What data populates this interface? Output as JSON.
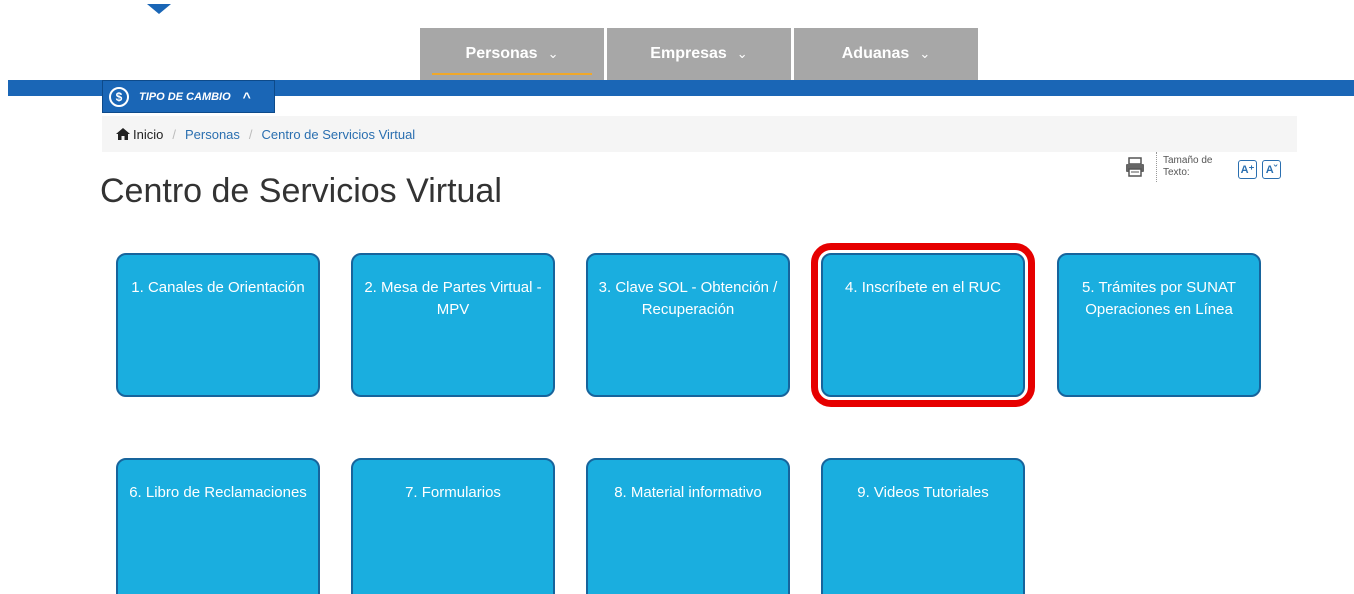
{
  "nav": {
    "tabs": [
      {
        "label": "Personas",
        "chevron": "⌄"
      },
      {
        "label": "Empresas",
        "chevron": "⌄"
      },
      {
        "label": "Aduanas",
        "chevron": "⌄"
      }
    ]
  },
  "tipo_cambio": {
    "label": "TIPO DE CAMBIO",
    "icon": "dollar-icon",
    "toggle": "^"
  },
  "breadcrumb": {
    "home": "Inicio",
    "level1": "Personas",
    "current": "Centro de Servicios Virtual",
    "separator": "/"
  },
  "tools": {
    "text_size_label": "Tamaño de Texto:",
    "increase": "A⁺",
    "decrease": "Aˇ"
  },
  "page_title": "Centro de Servicios Virtual",
  "cards": [
    {
      "label": "1. Canales de Orientación"
    },
    {
      "label": "2. Mesa de Partes Virtual - MPV"
    },
    {
      "label": "3. Clave SOL - Obtención / Recuperación"
    },
    {
      "label": "4. Inscríbete en el RUC"
    },
    {
      "label": "5. Trámites por SUNAT Operaciones en Línea"
    },
    {
      "label": "6. Libro de Reclamaciones"
    },
    {
      "label": "7. Formularios"
    },
    {
      "label": "8. Material informativo"
    },
    {
      "label": "9. Videos Tutoriales"
    }
  ],
  "colors": {
    "brand_blue": "#1a66b6",
    "card_blue": "#1aaedf",
    "highlight": "#e60000",
    "nav_gray": "#a7a7a7"
  }
}
